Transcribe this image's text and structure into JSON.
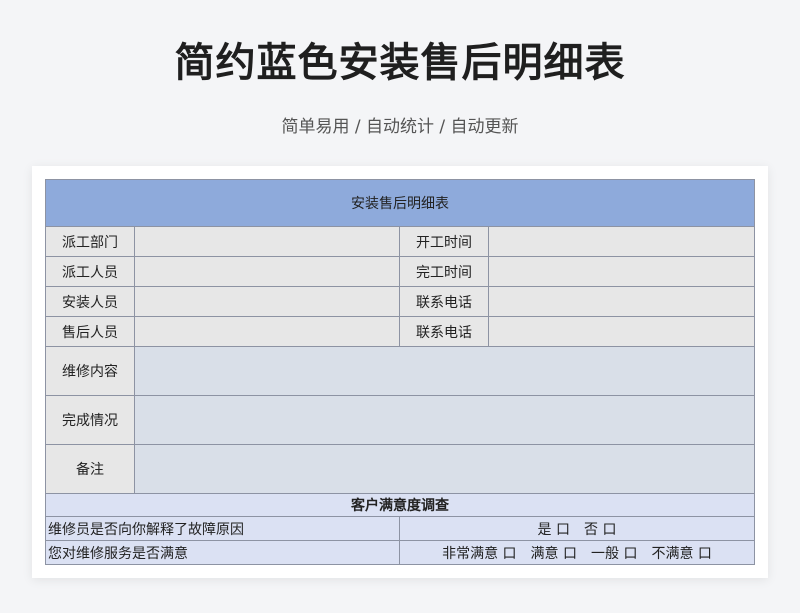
{
  "header": {
    "title": "简约蓝色安装售后明细表",
    "subtitle": "简单易用 / 自动统计 / 自动更新"
  },
  "sheet": {
    "title": "安装售后明细表",
    "rows": [
      {
        "left_label": "派工部门",
        "right_label": "开工时间"
      },
      {
        "left_label": "派工人员",
        "right_label": "完工时间"
      },
      {
        "left_label": "安装人员",
        "right_label": "联系电话"
      },
      {
        "left_label": "售后人员",
        "right_label": "联系电话"
      }
    ],
    "tall_rows": [
      {
        "label": "维修内容"
      },
      {
        "label": "完成情况"
      },
      {
        "label": "备注"
      }
    ],
    "survey": {
      "title": "客户满意度调查",
      "questions": [
        {
          "question": "维修员是否向你解释了故障原因",
          "options": "是 口　否 口"
        },
        {
          "question": "您对维修服务是否满意",
          "options": "非常满意 口　满意 口　一般 口　不满意 口"
        }
      ]
    }
  },
  "colors": {
    "title_band": "#8eaadb",
    "label_cell": "#e7e7e7",
    "tall_value_cell": "#d9dfe8",
    "survey_cell": "#dbe1f3"
  }
}
